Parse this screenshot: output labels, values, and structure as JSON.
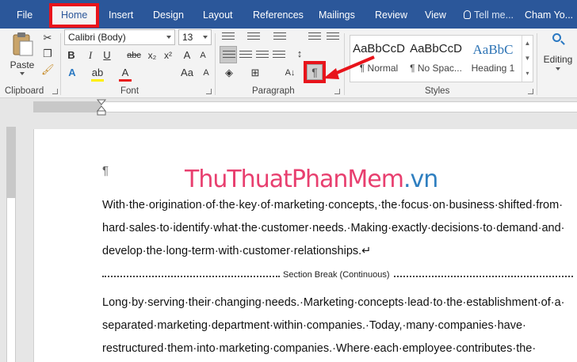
{
  "tabs": [
    {
      "label": "File",
      "active": false
    },
    {
      "label": "Home",
      "active": true
    },
    {
      "label": "Insert",
      "active": false
    },
    {
      "label": "Design",
      "active": false
    },
    {
      "label": "Layout",
      "active": false
    },
    {
      "label": "References",
      "active": false
    },
    {
      "label": "Mailings",
      "active": false
    },
    {
      "label": "Review",
      "active": false
    },
    {
      "label": "View",
      "active": false
    }
  ],
  "tell_me": "Tell me...",
  "user": "Cham Yo...",
  "clipboard": {
    "paste_label": "Paste",
    "group_label": "Clipboard"
  },
  "font": {
    "family": "Calibri (Body)",
    "size": "13",
    "group_label": "Font"
  },
  "paragraph": {
    "group_label": "Paragraph",
    "show_marks_glyph": "¶"
  },
  "styles": {
    "group_label": "Styles",
    "items": [
      {
        "sample": "AaBbCcD",
        "name": "¶ Normal"
      },
      {
        "sample": "AaBbCcD",
        "name": "¶ No Spac..."
      },
      {
        "sample": "AaBbC",
        "name": "Heading 1"
      }
    ]
  },
  "editing": {
    "label": "Editing"
  },
  "document": {
    "pilcrow": "¶",
    "watermark_part1": "ThuThuat",
    "watermark_part2": "PhanMem",
    "watermark_part3": ".vn",
    "lines": [
      "With·the·origination·of·the·key·of·marketing·concepts,·the·focus·on·business·shifted·from·",
      "hard·sales·to·identify·what·the·customer·needs.·Making·exactly·decisions·to·demand·and·",
      "develop·the·long-term·with·customer·relationships.↵"
    ],
    "section_break": "Section Break (Continuous)",
    "lines2": [
      "Long·by·serving·their·changing·needs.·Marketing·concepts·lead·to·the·establishment·of·a·",
      "separated·marketing·department·within·companies.·Today,·many·companies·have·",
      "restructured·them·into·marketing·companies.·Where·each·employee·contributes·the·"
    ]
  },
  "colors": {
    "accent": "#2b579a",
    "highlight": "#e8141b"
  }
}
